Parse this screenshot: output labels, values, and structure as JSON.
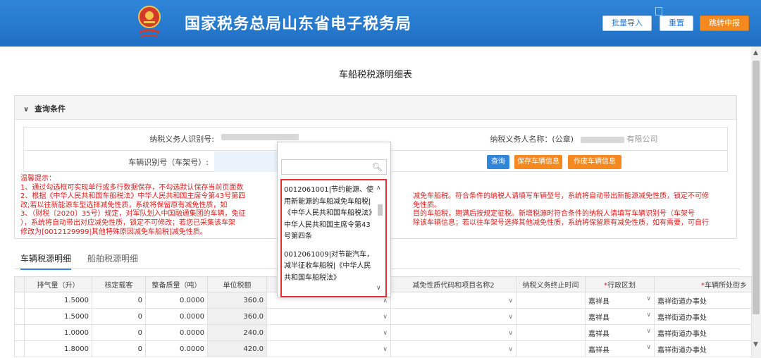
{
  "header": {
    "title": "国家税务总局山东省电子税务局",
    "batch_import": "批量导入",
    "reset": "重置",
    "jump_declare": "跳转申报",
    "colors": {
      "header_bg": "#2a7fd4",
      "accent_orange": "#f5891f"
    }
  },
  "page_title": "车船税税源明细表",
  "query": {
    "toggle_label": "查询条件",
    "taxpayer_id_label": "纳税义务人识别号:",
    "taxpayer_name_label": "纳税义务人名称：(公章)",
    "taxpayer_name_suffix": "有限公司",
    "vehicle_id_label": "车辆识别号（车架号）:",
    "btn_query": "查询",
    "btn_save": "保存车辆信息",
    "btn_cancel": "作废车辆信息"
  },
  "tips": {
    "title": "温馨提示：",
    "lines": [
      "1、通过勾选框可实现单行或多行数据保存，不勾选默认保存当前页面数",
      "2、根据《中华人民共和国车船税法》中华人民共和国主席令第43号第四",
      "改;若以往新能源车型选择减免性质，系统将保留原有减免性质，如",
      "3、（财税〔2020〕35号）规定，对军队划入中国融通集团的车辆，免征",
      "），系统将自动带出对应减免性质，锁定不可修改；若您已采集该车架",
      "修改为[0012129999|其他特殊原因减免车船税]减免性质。"
    ],
    "right_lines": [
      "减免车船税。符合条件的纳税人请填写车辆型号，系统将自动带出新能源减免性质，锁定不可修",
      "免性质。",
      "目的车船税，期满后按规定征税。新增税源时符合条件的纳税人请填写车辆识别号（车架号",
      "除该车辆信息；若以往车架号选择其他减免性质，系统将保留原有减免性质，如有需要，可自行"
    ]
  },
  "tabs": {
    "vehicle": "车辆税源明细",
    "ship": "船舶税源明细"
  },
  "table": {
    "headers": {
      "displacement": "排气量（升）",
      "seats": "核定载客",
      "curb_weight": "整备质量（吨）",
      "unit_tax": "单位税额",
      "reduction2": "减免性质代码和项目名称2",
      "end_time": "纳税义务终止时间",
      "district": "行政区划",
      "street": "车辆所处街乡"
    },
    "rows": [
      {
        "displacement": "1.5000",
        "seats": "0",
        "weight": "0.0000",
        "tax": "360.0",
        "district": "嘉祥县",
        "street": "嘉祥街道办事处"
      },
      {
        "displacement": "1.5000",
        "seats": "0",
        "weight": "0.0000",
        "tax": "360.0",
        "district": "嘉祥县",
        "street": "嘉祥街道办事处"
      },
      {
        "displacement": "1.0000",
        "seats": "0",
        "weight": "0.0000",
        "tax": "240.0",
        "district": "嘉祥县",
        "street": "嘉祥街道办事处"
      },
      {
        "displacement": "1.8000",
        "seats": "0",
        "weight": "0.0000",
        "tax": "420.0",
        "district": "嘉祥县",
        "street": "嘉祥街道办事处"
      }
    ]
  },
  "dropdown": {
    "options": [
      "0012061001|节约能源、使用新能源的车船减免车船税|《中华人民共和国车船税法》 中华人民共和国主席令第43号第四条",
      "0012061009|对节能汽车，减半征收车船税|《中华人民共和国车船税法》"
    ]
  }
}
